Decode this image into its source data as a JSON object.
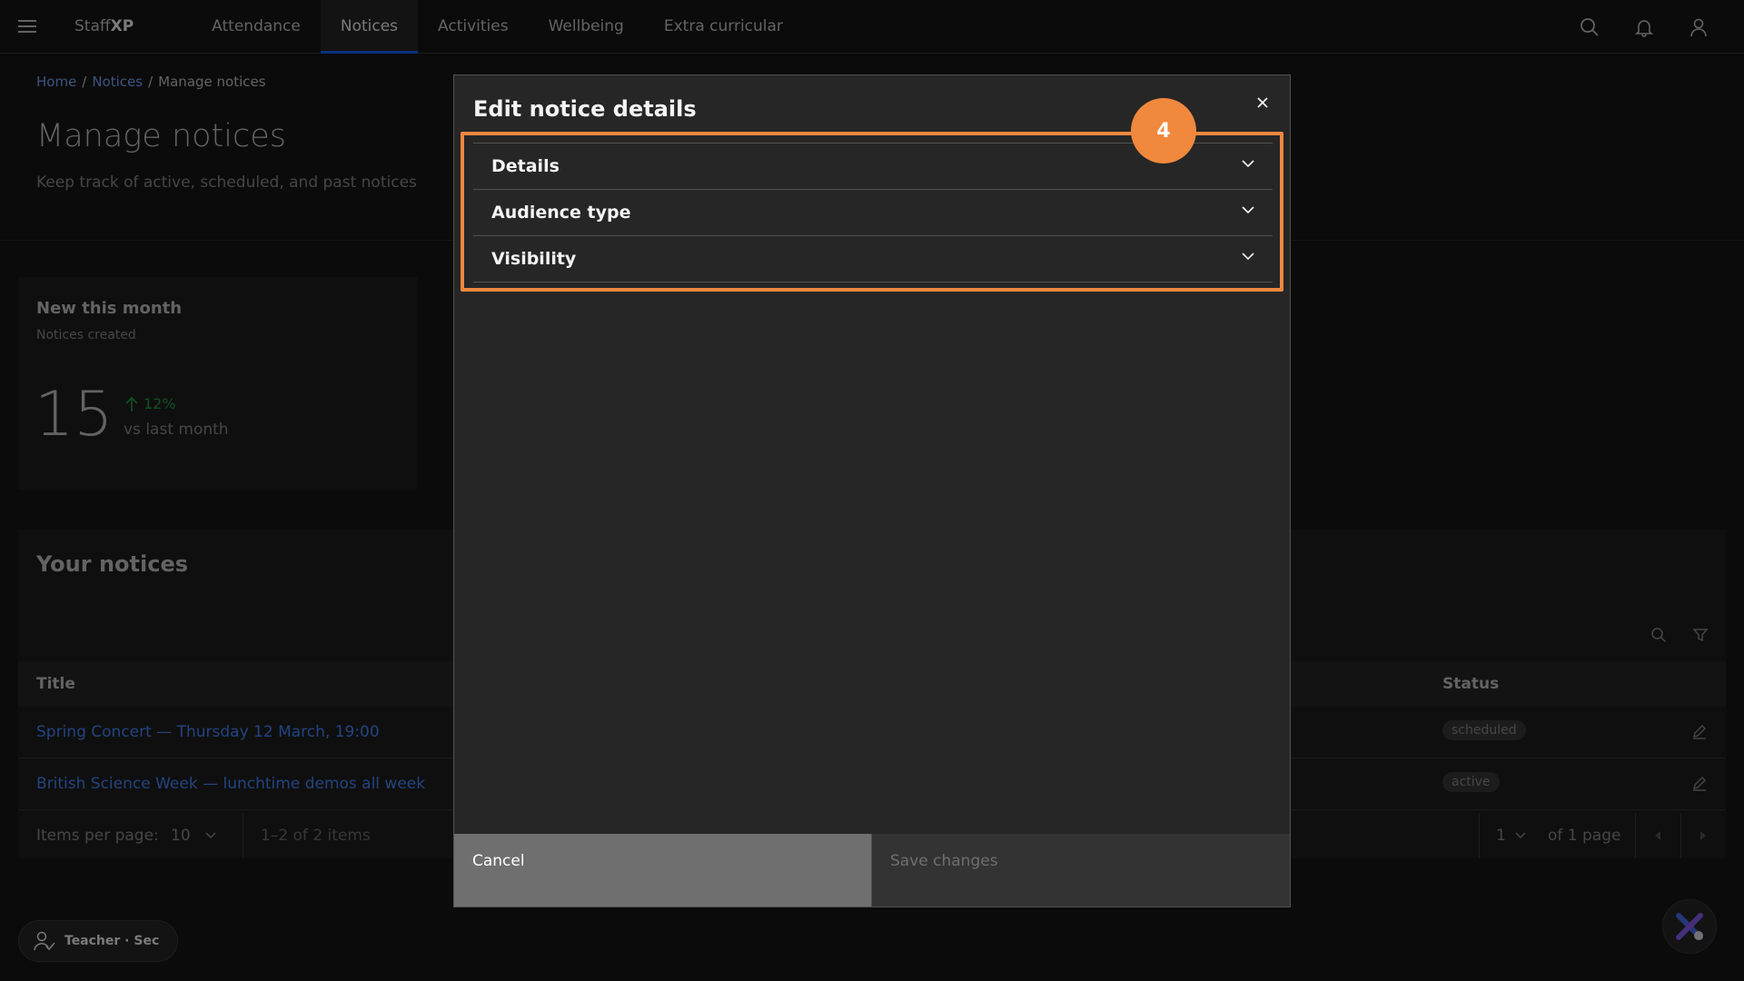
{
  "header": {
    "brand_prefix": "Staff",
    "brand_suffix": "XP",
    "nav": [
      {
        "label": "Attendance"
      },
      {
        "label": "Notices"
      },
      {
        "label": "Activities"
      },
      {
        "label": "Wellbeing"
      },
      {
        "label": "Extra curricular"
      }
    ],
    "active_nav": "Notices",
    "icons": [
      "menu-icon",
      "search-icon",
      "notification-icon",
      "user-icon"
    ]
  },
  "breadcrumb": {
    "items": [
      "Home",
      "Notices",
      "Manage notices"
    ],
    "separator": "/"
  },
  "page": {
    "title": "Manage notices",
    "subtitle": "Keep track of active, scheduled, and past notices"
  },
  "stat_card": {
    "title": "New this month",
    "subtitle": "Notices created",
    "value": "15",
    "change": "12%",
    "compare": "vs last month"
  },
  "notices": {
    "title": "Your notices",
    "columns": {
      "title": "Title",
      "status": "Status"
    },
    "rows": [
      {
        "title": "Spring Concert — Thursday 12 March, 19:00",
        "status": "scheduled"
      },
      {
        "title": "British Science Week — lunchtime demos all week",
        "status": "active"
      }
    ],
    "pagination": {
      "items_per_page_label": "Items per page:",
      "items_per_page": "10",
      "range": "1–2 of 2 items",
      "page": "1",
      "of_pages": "of 1 page"
    }
  },
  "role_chip": {
    "label": "Teacher · Sec"
  },
  "modal": {
    "title": "Edit notice details",
    "sections": [
      {
        "label": "Details"
      },
      {
        "label": "Audience type"
      },
      {
        "label": "Visibility"
      }
    ],
    "cancel_label": "Cancel",
    "save_label": "Save changes",
    "step_badge": "4"
  },
  "colors": {
    "accent": "#0f62fe",
    "link": "#78a9ff",
    "positive": "#24a148",
    "highlight": "#f0883e"
  }
}
